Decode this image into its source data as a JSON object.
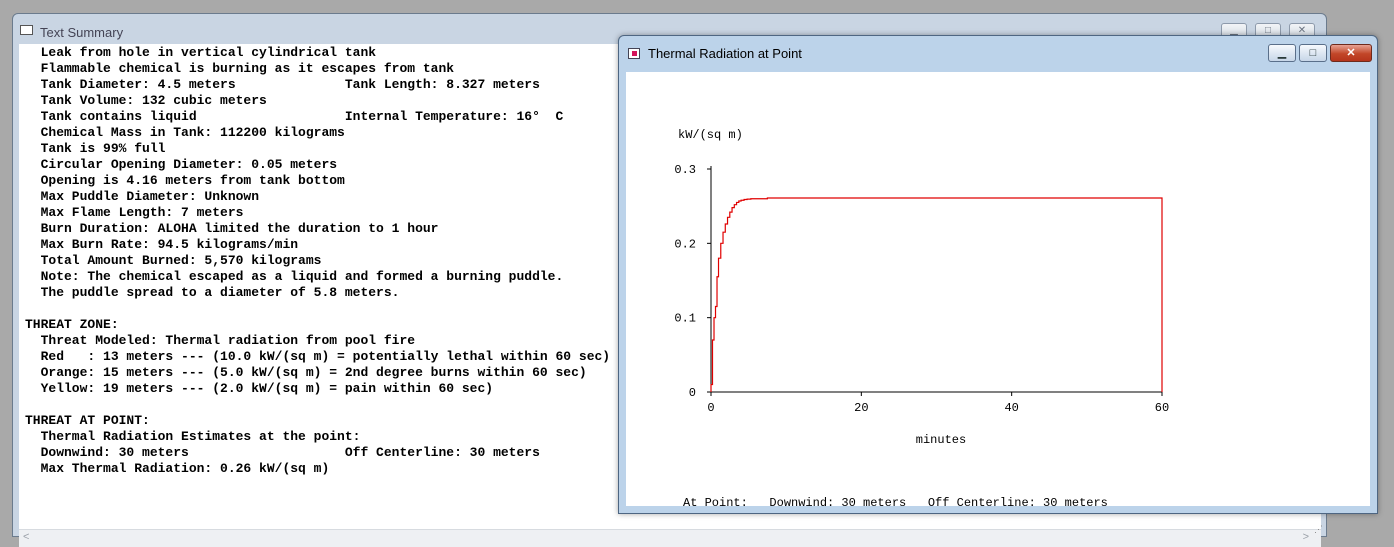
{
  "text_summary": {
    "title": "Text Summary",
    "icon": "text-document-icon",
    "lines": [
      "  Leak from hole in vertical cylindrical tank",
      "  Flammable chemical is burning as it escapes from tank",
      "  Tank Diameter: 4.5 meters              Tank Length: 8.327 meters",
      "  Tank Volume: 132 cubic meters",
      "  Tank contains liquid                   Internal Temperature: 16°  C",
      "  Chemical Mass in Tank: 112200 kilograms",
      "  Tank is 99% full",
      "  Circular Opening Diameter: 0.05 meters",
      "  Opening is 4.16 meters from tank bottom",
      "  Max Puddle Diameter: Unknown",
      "  Max Flame Length: 7 meters",
      "  Burn Duration: ALOHA limited the duration to 1 hour",
      "  Max Burn Rate: 94.5 kilograms/min",
      "  Total Amount Burned: 5,570 kilograms",
      "  Note: The chemical escaped as a liquid and formed a burning puddle.",
      "  The puddle spread to a diameter of 5.8 meters.",
      "",
      "THREAT ZONE:",
      "  Threat Modeled: Thermal radiation from pool fire",
      "  Red   : 13 meters --- (10.0 kW/(sq m) = potentially lethal within 60 sec)",
      "  Orange: 15 meters --- (5.0 kW/(sq m) = 2nd degree burns within 60 sec)",
      "  Yellow: 19 meters --- (2.0 kW/(sq m) = pain within 60 sec)",
      "",
      "THREAT AT POINT:",
      "  Thermal Radiation Estimates at the point:",
      "  Downwind: 30 meters                    Off Centerline: 30 meters",
      "  Max Thermal Radiation: 0.26 kW/(sq m)"
    ]
  },
  "thermal_window": {
    "title": "Thermal Radiation at Point",
    "icon": "chart-window-icon",
    "footer": "At Point:   Downwind: 30 meters   Off Centerline: 30 meters"
  },
  "window_controls": {
    "minimize": "▁",
    "maximize": "□",
    "close": "✕"
  },
  "colors": {
    "series": "#e00000",
    "axis": "#000000"
  },
  "chart_data": {
    "type": "line",
    "step": true,
    "ylabel": "kW/(sq m)",
    "xlabel": "minutes",
    "xlim": [
      0,
      60
    ],
    "ylim": [
      0,
      0.3
    ],
    "xticks": [
      "0",
      "20",
      "40",
      "60"
    ],
    "xtick_values": [
      0,
      20,
      40,
      60
    ],
    "yticks": [
      "0",
      "0.1",
      "0.2",
      "0.3"
    ],
    "ytick_values": [
      0,
      0.1,
      0.2,
      0.3
    ],
    "series": [
      {
        "x": [
          0,
          0.2,
          0.4,
          0.6,
          0.8,
          1.0,
          1.3,
          1.6,
          1.9,
          2.2,
          2.5,
          2.8,
          3.1,
          3.4,
          3.7,
          4.0,
          4.4,
          4.8,
          5.3,
          5.8,
          6.5,
          7.5,
          60
        ],
        "y": [
          0.01,
          0.07,
          0.1,
          0.115,
          0.155,
          0.18,
          0.2,
          0.215,
          0.226,
          0.235,
          0.242,
          0.248,
          0.252,
          0.255,
          0.257,
          0.258,
          0.259,
          0.2595,
          0.26,
          0.26,
          0.26,
          0.261,
          0.261
        ]
      }
    ]
  }
}
